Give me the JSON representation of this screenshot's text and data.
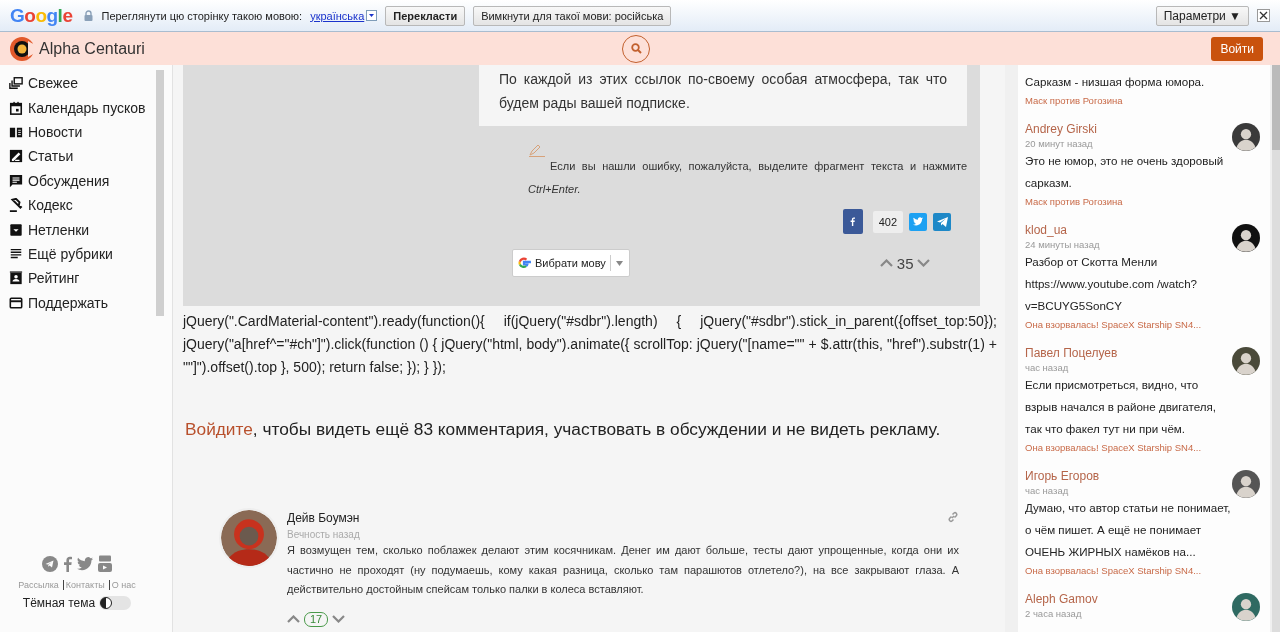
{
  "translate_bar": {
    "logo": "Google",
    "prompt": "Переглянути цю сторінку такою мовою:",
    "language": "українська",
    "translate_button": "Перекласти",
    "disable_button": "Вимкнути для такої мови: російська",
    "options_button": "Параметри ▼"
  },
  "header": {
    "site_name": "Alpha Centauri",
    "login_button": "Войти"
  },
  "sidebar": {
    "items": [
      {
        "label": "Свежее"
      },
      {
        "label": "Календарь пусков"
      },
      {
        "label": "Новости"
      },
      {
        "label": "Статьи"
      },
      {
        "label": "Обсуждения"
      },
      {
        "label": "Кодекс"
      },
      {
        "label": "Нетленки"
      },
      {
        "label": "Ещё рубрики"
      },
      {
        "label": "Рейтинг"
      },
      {
        "label": "Поддержать"
      }
    ],
    "footer_links": [
      "Рассылка",
      "Контакты",
      "О нас"
    ],
    "dark_theme": {
      "label": "Тёмная тема",
      "on": false
    }
  },
  "article": {
    "subscribe_text": "По каждой из этих ссылок по-своему особая атмосфера, так что будем рады вашей подписке.",
    "error_note": "Если вы нашли ошибку, пожалуйста, выделите фрагмент текста и нажмите *Ctrl+Enter.*",
    "share_count": "402",
    "language_widget": "Вибрати мову",
    "rating": "35"
  },
  "code_text": "jQuery(\".CardMaterial-content\").ready(function(){ if(jQuery(\"#sdbr\").length) { jQuery(\"#sdbr\").stick_in_parent({offset_top:50}); jQuery(\"a[href^=\"#ch\"]\").click(function () { jQuery(\"html, body\").animate({ scrollTop: jQuery(\"[name=\"\" + $.attr(this, \"href\").substr(1) + \"\"]\").offset().top }, 500); return false; }); } });",
  "login_prompt": {
    "link": "Войдите",
    "text": ", чтобы видеть ещё 83 комментария, участвовать в обсуждении и не видеть рекламу."
  },
  "comment": {
    "author": "Дейв Боумэн",
    "time": "Вечность назад",
    "text": "Я возмущен тем, сколько поблажек делают этим косячникам. Денег им дают больше, тесты дают упрощенные, когда они их частично не проходят (ну подумаешь, кому какая разница, сколько там парашютов отлетело?), на все закрывают глаза. А действительно достойным спейсам только палки в колеса вставляют.",
    "votes": "17"
  },
  "feed": [
    {
      "text": "Сарказм - низшая форма юмора.",
      "topic": "Маск против Рогозина"
    },
    {
      "author": "Andrey Girski",
      "time": "20 минут назад",
      "text": "Это не юмор, это не очень здоровый сарказм.",
      "topic": "Маск против Рогозина"
    },
    {
      "author": "klod_ua",
      "time": "24 минуты назад",
      "text": "Разбор от Скотта Менли https://www.youtube.com /watch?v=BCUYG5SonCY",
      "topic": "Она взорвалась! SpaceX Starship SN4..."
    },
    {
      "author": "Павел Поцелуев",
      "time": "час назад",
      "text": "Если присмотреться, видно, что взрыв начался в районе двигателя, так что факел тут ни при чём.",
      "topic": "Она взорвалась! SpaceX Starship SN4..."
    },
    {
      "author": "Игорь Егоров",
      "time": "час назад",
      "text": "Думаю, что автор статьи не понимает, о чём пишет. А ещё не понимает ОЧЕНЬ ЖИРНЫХ намёков на...",
      "topic": "Она взорвалась! SpaceX Starship SN4..."
    },
    {
      "author": "Aleph Gamov",
      "time": "2 часа назад"
    }
  ]
}
